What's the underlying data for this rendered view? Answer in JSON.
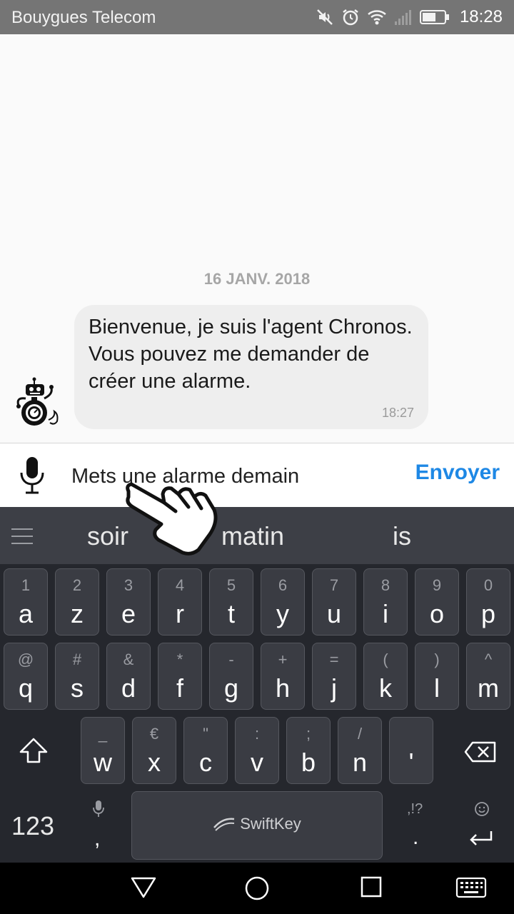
{
  "status_bar": {
    "carrier": "Bouygues Telecom",
    "time": "18:28",
    "icons": [
      "mute-icon",
      "alarm-icon",
      "wifi-icon",
      "signal-icon",
      "battery-icon"
    ]
  },
  "chat": {
    "date": "16 JANV. 2018",
    "messages": [
      {
        "text": "Bienvenue, je suis l'agent Chronos. Vous pouvez me demander de créer une alarme.",
        "time": "18:27",
        "avatar": "robot-stopwatch-icon"
      }
    ]
  },
  "compose": {
    "input_value": "Mets une alarme demain",
    "send_label": "Envoyer"
  },
  "keyboard": {
    "suggestions": [
      "soir",
      "matin",
      "is"
    ],
    "row1": [
      {
        "main": "a",
        "sub": "1"
      },
      {
        "main": "z",
        "sub": "2"
      },
      {
        "main": "e",
        "sub": "3"
      },
      {
        "main": "r",
        "sub": "4"
      },
      {
        "main": "t",
        "sub": "5"
      },
      {
        "main": "y",
        "sub": "6"
      },
      {
        "main": "u",
        "sub": "7"
      },
      {
        "main": "i",
        "sub": "8"
      },
      {
        "main": "o",
        "sub": "9"
      },
      {
        "main": "p",
        "sub": "0"
      }
    ],
    "row2": [
      {
        "main": "q",
        "sub": "@"
      },
      {
        "main": "s",
        "sub": "#"
      },
      {
        "main": "d",
        "sub": "&"
      },
      {
        "main": "f",
        "sub": "*"
      },
      {
        "main": "g",
        "sub": "-"
      },
      {
        "main": "h",
        "sub": "+"
      },
      {
        "main": "j",
        "sub": "="
      },
      {
        "main": "k",
        "sub": "("
      },
      {
        "main": "l",
        "sub": ")"
      },
      {
        "main": "m",
        "sub": "^"
      }
    ],
    "row3": [
      {
        "main": "w",
        "sub": "_"
      },
      {
        "main": "x",
        "sub": "€"
      },
      {
        "main": "c",
        "sub": "\""
      },
      {
        "main": "v",
        "sub": ":"
      },
      {
        "main": "b",
        "sub": ";"
      },
      {
        "main": "n",
        "sub": "/"
      },
      {
        "main": "'",
        "sub": ""
      }
    ],
    "numbers_label": "123",
    "comma_label": ",",
    "period_label": ".",
    "punct_label": ",!?",
    "space_brand": "SwiftKey",
    "accent_color": "#1e88e5"
  },
  "nav_bar": {
    "buttons": [
      "back-icon",
      "home-icon",
      "recents-icon",
      "keyboard-switch-icon"
    ]
  }
}
